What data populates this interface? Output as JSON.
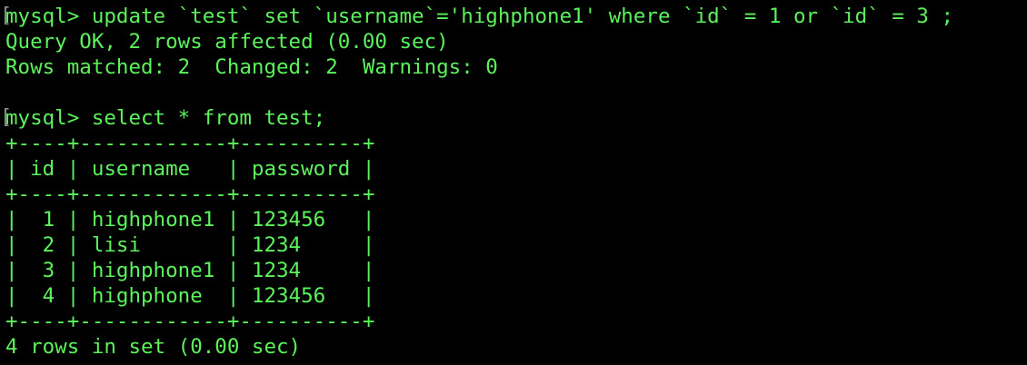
{
  "colors": {
    "background": "#000000",
    "text": "#5cf25c",
    "marker": "#8a8a8a"
  },
  "terminal": {
    "lines": [
      {
        "kind": "prompt",
        "text": "mysql> update `test` set `username`='highphone1' where `id` = 1 or `id` = 3 ;"
      },
      {
        "kind": "output",
        "text": "Query OK, 2 rows affected (0.00 sec)"
      },
      {
        "kind": "output",
        "text": "Rows matched: 2  Changed: 2  Warnings: 0"
      },
      {
        "kind": "blank",
        "text": ""
      },
      {
        "kind": "prompt",
        "text": "mysql> select * from test;"
      },
      {
        "kind": "output",
        "text": "+----+------------+----------+"
      },
      {
        "kind": "output",
        "text": "| id | username   | password |"
      },
      {
        "kind": "output",
        "text": "+----+------------+----------+"
      },
      {
        "kind": "output",
        "text": "|  1 | highphone1 | 123456   |"
      },
      {
        "kind": "output",
        "text": "|  2 | lisi       | 1234     |"
      },
      {
        "kind": "output",
        "text": "|  3 | highphone1 | 1234     |"
      },
      {
        "kind": "output",
        "text": "|  4 | highphone  | 123456   |"
      },
      {
        "kind": "output",
        "text": "+----+------------+----------+"
      },
      {
        "kind": "output",
        "text": "4 rows in set (0.00 sec)"
      }
    ],
    "prompt_marker": "["
  }
}
